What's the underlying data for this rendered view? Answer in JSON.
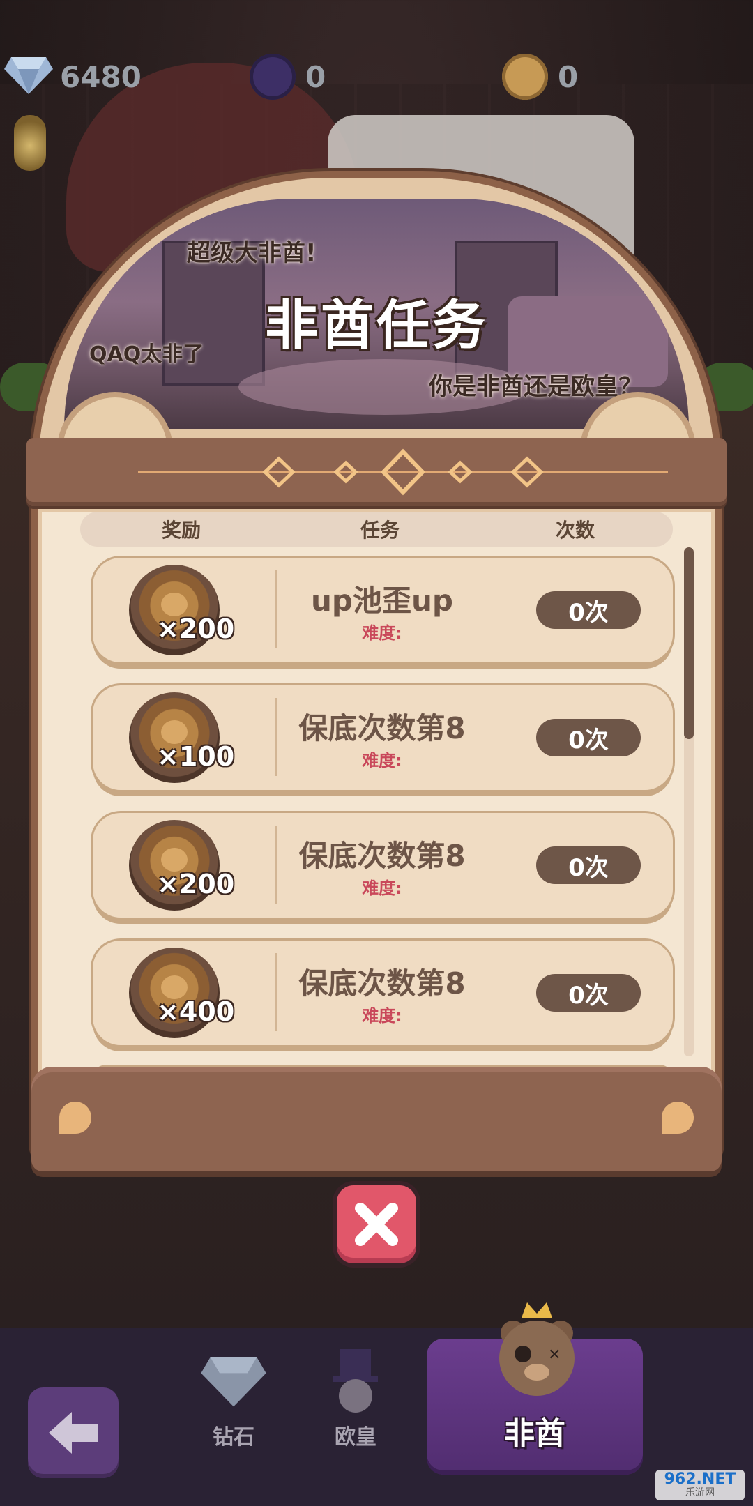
{
  "currencies": [
    {
      "name": "diamond",
      "icon": "diamond-icon",
      "value": "6480"
    },
    {
      "name": "europe-token",
      "icon": "top-hat-coin-icon",
      "value": "0"
    },
    {
      "name": "bear-coin",
      "icon": "bear-coin-icon",
      "value": "0"
    }
  ],
  "banner": {
    "top_label": "超级大非酋!",
    "title": "非酋任务",
    "left_label": "QAQ太非了",
    "right_label": "你是非酋还是欧皇？"
  },
  "table": {
    "headers": [
      "奖励",
      "任务",
      "次数"
    ],
    "rows": [
      {
        "reward": "×200",
        "task": "up池歪up",
        "difficulty": "难度:",
        "count": "0次"
      },
      {
        "reward": "×100",
        "task": "保底次数第8",
        "difficulty": "难度:",
        "count": "0次"
      },
      {
        "reward": "×200",
        "task": "保底次数第8",
        "difficulty": "难度:",
        "count": "0次"
      },
      {
        "reward": "×400",
        "task": "保底次数第8",
        "difficulty": "难度:",
        "count": "0次"
      }
    ]
  },
  "nav": {
    "tabs": [
      {
        "label": "钻石",
        "icon": "diamond-icon"
      },
      {
        "label": "欧皇",
        "icon": "top-hat-bear-icon"
      },
      {
        "label": "非酋",
        "icon": "crowned-bear-icon",
        "active": true
      }
    ]
  },
  "watermark": {
    "line1": "962.NET",
    "line2": "乐游网"
  },
  "colors": {
    "accent": "#e1576a",
    "panel": "#e3c7a6",
    "pill": "#6e5648",
    "difficulty": "#c9485a",
    "nav_active": "#6b3d8e"
  }
}
